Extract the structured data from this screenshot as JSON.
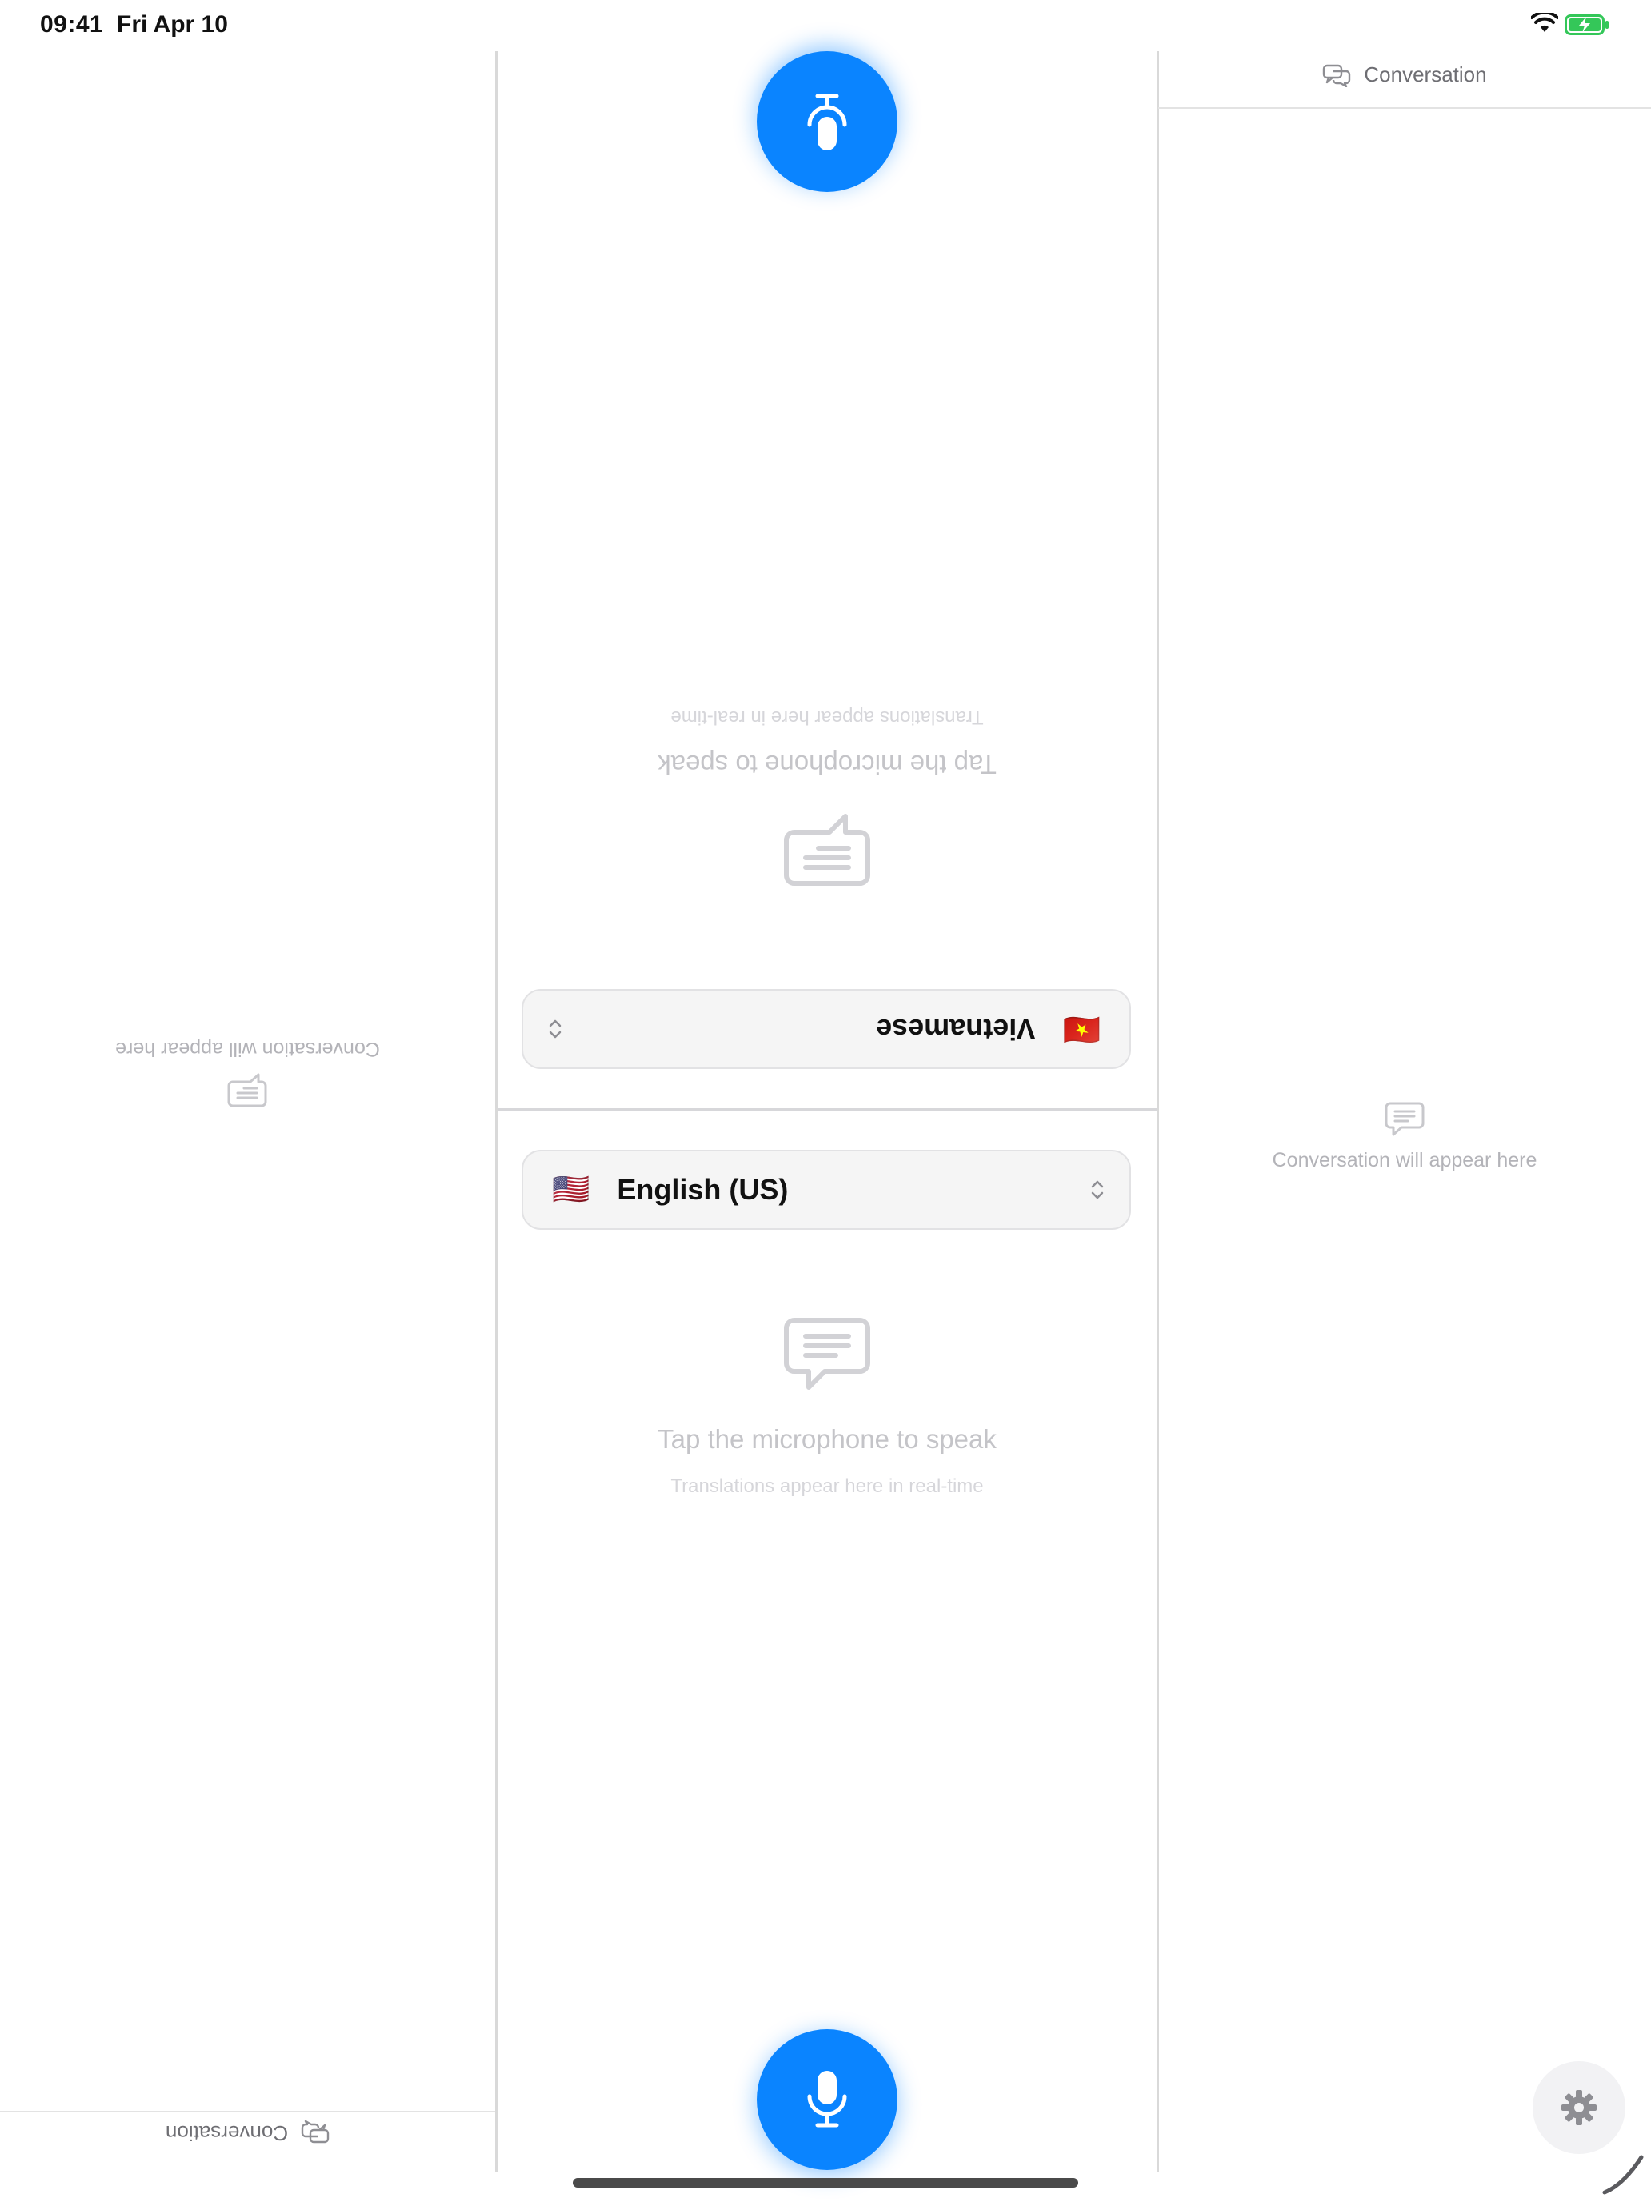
{
  "status_bar": {
    "time": "09:41",
    "date": "Fri Apr 10"
  },
  "left_panel": {
    "header_label": "Conversation",
    "empty_text": "Conversation will appear here"
  },
  "right_panel": {
    "header_label": "Conversation",
    "empty_text": "Conversation will appear here"
  },
  "top_half": {
    "language": {
      "flag": "🇻🇳",
      "name": "Vietnamese"
    },
    "prompt": "Tap the microphone to speak",
    "hint": "Translations appear here in real-time"
  },
  "bottom_half": {
    "language": {
      "flag": "🇺🇸",
      "name": "English (US)"
    },
    "prompt": "Tap the microphone to speak",
    "hint": "Translations appear here in real-time"
  },
  "colors": {
    "accent": "#0a84ff",
    "battery": "#34c759"
  },
  "icons": {
    "mic": "microphone-icon",
    "settings": "gear-icon",
    "conversation": "speech-bubbles-icon",
    "empty_state": "message-lines-icon",
    "selector": "chevron-up-down-icon"
  }
}
